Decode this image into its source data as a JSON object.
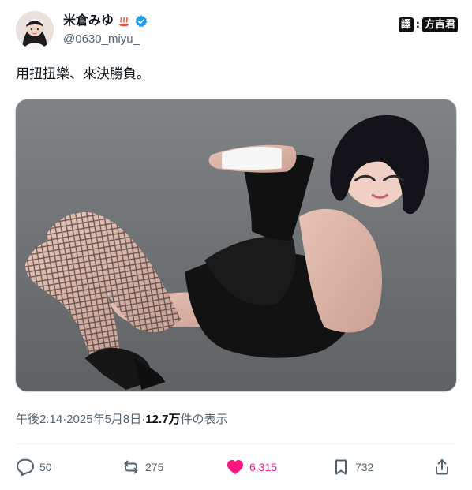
{
  "author": {
    "display_name": "米倉みゆ",
    "handle": "@0630_miyu_",
    "name_emoji": "hot-springs-icon",
    "verified_icon": "verified-badge-icon"
  },
  "watermark": {
    "left": "譯",
    "sep": ":",
    "right": "方吉君"
  },
  "tweet": {
    "text": "用扭扭樂、來決勝負。"
  },
  "meta": {
    "time": "午後2:14",
    "sep1": " · ",
    "date": "2025年5月8日",
    "sep2": " · ",
    "views": "12.7万",
    "views_label": " 件の表示"
  },
  "actions": {
    "replies": "50",
    "reposts": "275",
    "likes": "6,315",
    "bookmarks": "732"
  },
  "colors": {
    "like": "#f91880",
    "muted": "#536471",
    "verified": "#1d9bf0"
  }
}
